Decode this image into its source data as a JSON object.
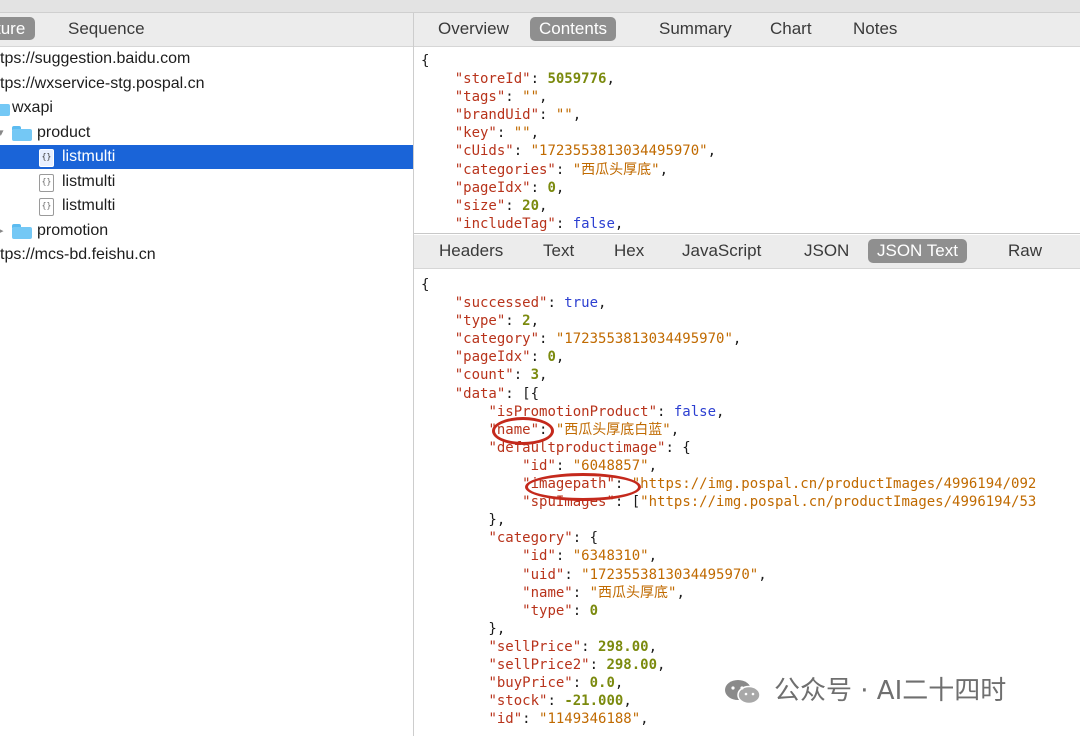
{
  "left_tabs": [
    "ture",
    "Sequence"
  ],
  "tree": [
    {
      "label": "tps://suggestion.baidu.com",
      "kind": "host"
    },
    {
      "label": "tps://wxservice-stg.pospal.cn",
      "kind": "host"
    },
    {
      "label": "wxapi",
      "kind": "folder"
    },
    {
      "label": "product",
      "kind": "folder"
    },
    {
      "label": "listmulti",
      "kind": "file",
      "selected": true
    },
    {
      "label": "listmulti",
      "kind": "file"
    },
    {
      "label": "listmulti",
      "kind": "file"
    },
    {
      "label": "promotion",
      "kind": "folder"
    },
    {
      "label": "tps://mcs-bd.feishu.cn",
      "kind": "host"
    }
  ],
  "top_tabs": [
    "Overview",
    "Contents",
    "Summary",
    "Chart",
    "Notes"
  ],
  "top_active": "Contents",
  "request_lines": [
    [
      [
        "p",
        "{"
      ]
    ],
    [
      [
        "p",
        "    "
      ],
      [
        "k",
        "\"storeId\""
      ],
      [
        "p",
        ": "
      ],
      [
        "n",
        "5059776"
      ],
      [
        "p",
        ","
      ]
    ],
    [
      [
        "p",
        "    "
      ],
      [
        "k",
        "\"tags\""
      ],
      [
        "p",
        ": "
      ],
      [
        "s",
        "\"\""
      ],
      [
        "p",
        ","
      ]
    ],
    [
      [
        "p",
        "    "
      ],
      [
        "k",
        "\"brandUid\""
      ],
      [
        "p",
        ": "
      ],
      [
        "s",
        "\"\""
      ],
      [
        "p",
        ","
      ]
    ],
    [
      [
        "p",
        "    "
      ],
      [
        "k",
        "\"key\""
      ],
      [
        "p",
        ": "
      ],
      [
        "s",
        "\"\""
      ],
      [
        "p",
        ","
      ]
    ],
    [
      [
        "p",
        "    "
      ],
      [
        "k",
        "\"cUids\""
      ],
      [
        "p",
        ": "
      ],
      [
        "s",
        "\"1723553813034495970\""
      ],
      [
        "p",
        ","
      ]
    ],
    [
      [
        "p",
        "    "
      ],
      [
        "k",
        "\"categories\""
      ],
      [
        "p",
        ": "
      ],
      [
        "s",
        "\"西瓜头厚底\""
      ],
      [
        "p",
        ","
      ]
    ],
    [
      [
        "p",
        "    "
      ],
      [
        "k",
        "\"pageIdx\""
      ],
      [
        "p",
        ": "
      ],
      [
        "n",
        "0"
      ],
      [
        "p",
        ","
      ]
    ],
    [
      [
        "p",
        "    "
      ],
      [
        "k",
        "\"size\""
      ],
      [
        "p",
        ": "
      ],
      [
        "n",
        "20"
      ],
      [
        "p",
        ","
      ]
    ],
    [
      [
        "p",
        "    "
      ],
      [
        "k",
        "\"includeTag\""
      ],
      [
        "p",
        ": "
      ],
      [
        "b",
        "false"
      ],
      [
        "p",
        ","
      ]
    ]
  ],
  "bottom_tabs": [
    "Headers",
    "Text",
    "Hex",
    "JavaScript",
    "JSON",
    "JSON Text",
    "Raw"
  ],
  "bottom_active": "JSON Text",
  "response_lines": [
    [
      [
        "p",
        "{"
      ]
    ],
    [
      [
        "p",
        "    "
      ],
      [
        "k",
        "\"successed\""
      ],
      [
        "p",
        ": "
      ],
      [
        "b",
        "true"
      ],
      [
        "p",
        ","
      ]
    ],
    [
      [
        "p",
        "    "
      ],
      [
        "k",
        "\"type\""
      ],
      [
        "p",
        ": "
      ],
      [
        "n",
        "2"
      ],
      [
        "p",
        ","
      ]
    ],
    [
      [
        "p",
        "    "
      ],
      [
        "k",
        "\"category\""
      ],
      [
        "p",
        ": "
      ],
      [
        "s",
        "\"1723553813034495970\""
      ],
      [
        "p",
        ","
      ]
    ],
    [
      [
        "p",
        "    "
      ],
      [
        "k",
        "\"pageIdx\""
      ],
      [
        "p",
        ": "
      ],
      [
        "n",
        "0"
      ],
      [
        "p",
        ","
      ]
    ],
    [
      [
        "p",
        "    "
      ],
      [
        "k",
        "\"count\""
      ],
      [
        "p",
        ": "
      ],
      [
        "n",
        "3"
      ],
      [
        "p",
        ","
      ]
    ],
    [
      [
        "p",
        "    "
      ],
      [
        "k",
        "\"data\""
      ],
      [
        "p",
        ": [{"
      ]
    ],
    [
      [
        "p",
        "        "
      ],
      [
        "k",
        "\"isPromotionProduct\""
      ],
      [
        "p",
        ": "
      ],
      [
        "b",
        "false"
      ],
      [
        "p",
        ","
      ]
    ],
    [
      [
        "p",
        "        "
      ],
      [
        "k",
        "\"name\""
      ],
      [
        "p",
        ": "
      ],
      [
        "s",
        "\"西瓜头厚底白蓝\""
      ],
      [
        "p",
        ","
      ]
    ],
    [
      [
        "p",
        "        "
      ],
      [
        "k",
        "\"defaultproductimage\""
      ],
      [
        "p",
        ": {"
      ]
    ],
    [
      [
        "p",
        "            "
      ],
      [
        "k",
        "\"id\""
      ],
      [
        "p",
        ": "
      ],
      [
        "s",
        "\"6048857\""
      ],
      [
        "p",
        ","
      ]
    ],
    [
      [
        "p",
        "            "
      ],
      [
        "k",
        "\"imagepath\""
      ],
      [
        "p",
        ": "
      ],
      [
        "s",
        "\"https://img.pospal.cn/productImages/4996194/092"
      ]
    ],
    [
      [
        "p",
        "            "
      ],
      [
        "k",
        "\"spuImages\""
      ],
      [
        "p",
        ": ["
      ],
      [
        "s",
        "\"https://img.pospal.cn/productImages/4996194/53"
      ]
    ],
    [
      [
        "p",
        "        },"
      ]
    ],
    [
      [
        "p",
        "        "
      ],
      [
        "k",
        "\"category\""
      ],
      [
        "p",
        ": {"
      ]
    ],
    [
      [
        "p",
        "            "
      ],
      [
        "k",
        "\"id\""
      ],
      [
        "p",
        ": "
      ],
      [
        "s",
        "\"6348310\""
      ],
      [
        "p",
        ","
      ]
    ],
    [
      [
        "p",
        "            "
      ],
      [
        "k",
        "\"uid\""
      ],
      [
        "p",
        ": "
      ],
      [
        "s",
        "\"1723553813034495970\""
      ],
      [
        "p",
        ","
      ]
    ],
    [
      [
        "p",
        "            "
      ],
      [
        "k",
        "\"name\""
      ],
      [
        "p",
        ": "
      ],
      [
        "s",
        "\"西瓜头厚底\""
      ],
      [
        "p",
        ","
      ]
    ],
    [
      [
        "p",
        "            "
      ],
      [
        "k",
        "\"type\""
      ],
      [
        "p",
        ": "
      ],
      [
        "n",
        "0"
      ]
    ],
    [
      [
        "p",
        "        },"
      ]
    ],
    [
      [
        "p",
        "        "
      ],
      [
        "k",
        "\"sellPrice\""
      ],
      [
        "p",
        ": "
      ],
      [
        "n",
        "298.00"
      ],
      [
        "p",
        ","
      ]
    ],
    [
      [
        "p",
        "        "
      ],
      [
        "k",
        "\"sellPrice2\""
      ],
      [
        "p",
        ": "
      ],
      [
        "n",
        "298.00"
      ],
      [
        "p",
        ","
      ]
    ],
    [
      [
        "p",
        "        "
      ],
      [
        "k",
        "\"buyPrice\""
      ],
      [
        "p",
        ": "
      ],
      [
        "n",
        "0.0"
      ],
      [
        "p",
        ","
      ]
    ],
    [
      [
        "p",
        "        "
      ],
      [
        "k",
        "\"stock\""
      ],
      [
        "p",
        ": "
      ],
      [
        "n",
        "-21.000"
      ],
      [
        "p",
        ","
      ]
    ],
    [
      [
        "p",
        "        "
      ],
      [
        "k",
        "\"id\""
      ],
      [
        "p",
        ": "
      ],
      [
        "s",
        "\"1149346188\""
      ],
      [
        "p",
        ","
      ]
    ]
  ],
  "colors": {
    "selection": "#1a64d8",
    "annotation": "#c4291c",
    "key": "#b8331b",
    "string": "#c06a00",
    "number": "#7b8a0e",
    "bool": "#2c3fd1"
  },
  "watermark": "公众号 · AI二十四时"
}
